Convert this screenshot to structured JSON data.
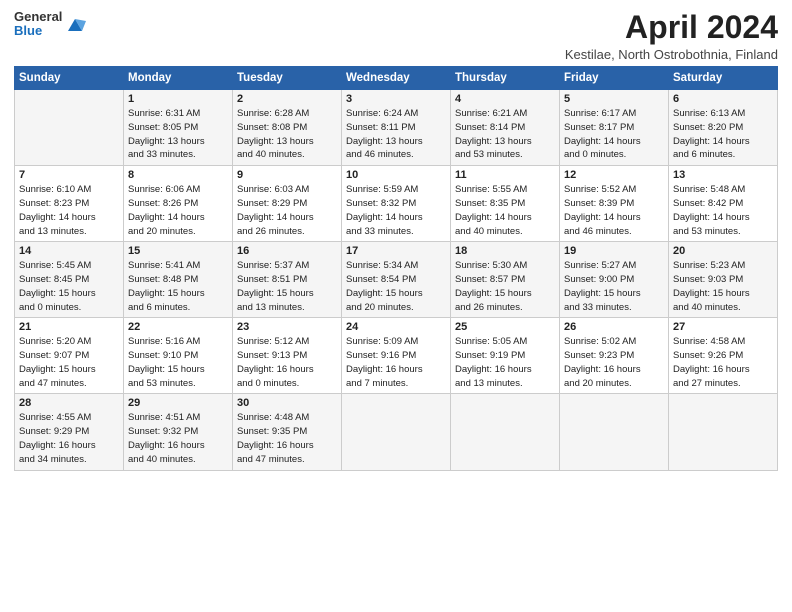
{
  "header": {
    "logo_general": "General",
    "logo_blue": "Blue",
    "month": "April 2024",
    "location": "Kestilae, North Ostrobothnia, Finland"
  },
  "weekdays": [
    "Sunday",
    "Monday",
    "Tuesday",
    "Wednesday",
    "Thursday",
    "Friday",
    "Saturday"
  ],
  "weeks": [
    [
      {
        "day": "",
        "lines": []
      },
      {
        "day": "1",
        "lines": [
          "Sunrise: 6:31 AM",
          "Sunset: 8:05 PM",
          "Daylight: 13 hours",
          "and 33 minutes."
        ]
      },
      {
        "day": "2",
        "lines": [
          "Sunrise: 6:28 AM",
          "Sunset: 8:08 PM",
          "Daylight: 13 hours",
          "and 40 minutes."
        ]
      },
      {
        "day": "3",
        "lines": [
          "Sunrise: 6:24 AM",
          "Sunset: 8:11 PM",
          "Daylight: 13 hours",
          "and 46 minutes."
        ]
      },
      {
        "day": "4",
        "lines": [
          "Sunrise: 6:21 AM",
          "Sunset: 8:14 PM",
          "Daylight: 13 hours",
          "and 53 minutes."
        ]
      },
      {
        "day": "5",
        "lines": [
          "Sunrise: 6:17 AM",
          "Sunset: 8:17 PM",
          "Daylight: 14 hours",
          "and 0 minutes."
        ]
      },
      {
        "day": "6",
        "lines": [
          "Sunrise: 6:13 AM",
          "Sunset: 8:20 PM",
          "Daylight: 14 hours",
          "and 6 minutes."
        ]
      }
    ],
    [
      {
        "day": "7",
        "lines": [
          "Sunrise: 6:10 AM",
          "Sunset: 8:23 PM",
          "Daylight: 14 hours",
          "and 13 minutes."
        ]
      },
      {
        "day": "8",
        "lines": [
          "Sunrise: 6:06 AM",
          "Sunset: 8:26 PM",
          "Daylight: 14 hours",
          "and 20 minutes."
        ]
      },
      {
        "day": "9",
        "lines": [
          "Sunrise: 6:03 AM",
          "Sunset: 8:29 PM",
          "Daylight: 14 hours",
          "and 26 minutes."
        ]
      },
      {
        "day": "10",
        "lines": [
          "Sunrise: 5:59 AM",
          "Sunset: 8:32 PM",
          "Daylight: 14 hours",
          "and 33 minutes."
        ]
      },
      {
        "day": "11",
        "lines": [
          "Sunrise: 5:55 AM",
          "Sunset: 8:35 PM",
          "Daylight: 14 hours",
          "and 40 minutes."
        ]
      },
      {
        "day": "12",
        "lines": [
          "Sunrise: 5:52 AM",
          "Sunset: 8:39 PM",
          "Daylight: 14 hours",
          "and 46 minutes."
        ]
      },
      {
        "day": "13",
        "lines": [
          "Sunrise: 5:48 AM",
          "Sunset: 8:42 PM",
          "Daylight: 14 hours",
          "and 53 minutes."
        ]
      }
    ],
    [
      {
        "day": "14",
        "lines": [
          "Sunrise: 5:45 AM",
          "Sunset: 8:45 PM",
          "Daylight: 15 hours",
          "and 0 minutes."
        ]
      },
      {
        "day": "15",
        "lines": [
          "Sunrise: 5:41 AM",
          "Sunset: 8:48 PM",
          "Daylight: 15 hours",
          "and 6 minutes."
        ]
      },
      {
        "day": "16",
        "lines": [
          "Sunrise: 5:37 AM",
          "Sunset: 8:51 PM",
          "Daylight: 15 hours",
          "and 13 minutes."
        ]
      },
      {
        "day": "17",
        "lines": [
          "Sunrise: 5:34 AM",
          "Sunset: 8:54 PM",
          "Daylight: 15 hours",
          "and 20 minutes."
        ]
      },
      {
        "day": "18",
        "lines": [
          "Sunrise: 5:30 AM",
          "Sunset: 8:57 PM",
          "Daylight: 15 hours",
          "and 26 minutes."
        ]
      },
      {
        "day": "19",
        "lines": [
          "Sunrise: 5:27 AM",
          "Sunset: 9:00 PM",
          "Daylight: 15 hours",
          "and 33 minutes."
        ]
      },
      {
        "day": "20",
        "lines": [
          "Sunrise: 5:23 AM",
          "Sunset: 9:03 PM",
          "Daylight: 15 hours",
          "and 40 minutes."
        ]
      }
    ],
    [
      {
        "day": "21",
        "lines": [
          "Sunrise: 5:20 AM",
          "Sunset: 9:07 PM",
          "Daylight: 15 hours",
          "and 47 minutes."
        ]
      },
      {
        "day": "22",
        "lines": [
          "Sunrise: 5:16 AM",
          "Sunset: 9:10 PM",
          "Daylight: 15 hours",
          "and 53 minutes."
        ]
      },
      {
        "day": "23",
        "lines": [
          "Sunrise: 5:12 AM",
          "Sunset: 9:13 PM",
          "Daylight: 16 hours",
          "and 0 minutes."
        ]
      },
      {
        "day": "24",
        "lines": [
          "Sunrise: 5:09 AM",
          "Sunset: 9:16 PM",
          "Daylight: 16 hours",
          "and 7 minutes."
        ]
      },
      {
        "day": "25",
        "lines": [
          "Sunrise: 5:05 AM",
          "Sunset: 9:19 PM",
          "Daylight: 16 hours",
          "and 13 minutes."
        ]
      },
      {
        "day": "26",
        "lines": [
          "Sunrise: 5:02 AM",
          "Sunset: 9:23 PM",
          "Daylight: 16 hours",
          "and 20 minutes."
        ]
      },
      {
        "day": "27",
        "lines": [
          "Sunrise: 4:58 AM",
          "Sunset: 9:26 PM",
          "Daylight: 16 hours",
          "and 27 minutes."
        ]
      }
    ],
    [
      {
        "day": "28",
        "lines": [
          "Sunrise: 4:55 AM",
          "Sunset: 9:29 PM",
          "Daylight: 16 hours",
          "and 34 minutes."
        ]
      },
      {
        "day": "29",
        "lines": [
          "Sunrise: 4:51 AM",
          "Sunset: 9:32 PM",
          "Daylight: 16 hours",
          "and 40 minutes."
        ]
      },
      {
        "day": "30",
        "lines": [
          "Sunrise: 4:48 AM",
          "Sunset: 9:35 PM",
          "Daylight: 16 hours",
          "and 47 minutes."
        ]
      },
      {
        "day": "",
        "lines": []
      },
      {
        "day": "",
        "lines": []
      },
      {
        "day": "",
        "lines": []
      },
      {
        "day": "",
        "lines": []
      }
    ]
  ]
}
